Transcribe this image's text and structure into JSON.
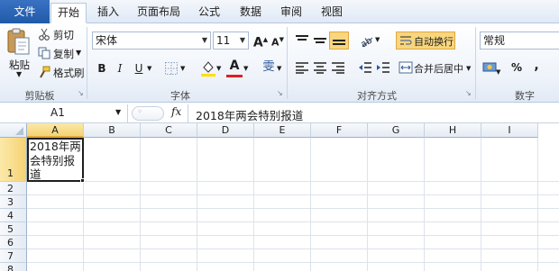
{
  "tabs": [
    {
      "label": "文件",
      "kind": "file"
    },
    {
      "label": "开始",
      "kind": "active"
    },
    {
      "label": "插入"
    },
    {
      "label": "页面布局"
    },
    {
      "label": "公式"
    },
    {
      "label": "数据"
    },
    {
      "label": "审阅"
    },
    {
      "label": "视图"
    }
  ],
  "clipboard": {
    "paste": "粘贴",
    "cut": "剪切",
    "copy": "复制",
    "format_painter": "格式刷",
    "group": "剪贴板"
  },
  "font": {
    "name": "宋体",
    "size": "11",
    "grow": "A",
    "shrink": "A",
    "bold": "B",
    "italic": "I",
    "underline": "U",
    "font_color_glyph": "A",
    "phonetic_glyph": "雯",
    "group": "字体"
  },
  "alignment": {
    "wrap_text": "自动换行",
    "merge_center": "合并后居中",
    "group": "对齐方式"
  },
  "number": {
    "format": "常规",
    "percent": "%",
    "comma": ",",
    "group": "数字"
  },
  "formula_bar": {
    "name_box": "A1",
    "fx": "fx",
    "content": "2018年两会特别报道"
  },
  "sheet": {
    "columns": [
      "A",
      "B",
      "C",
      "D",
      "E",
      "F",
      "G",
      "H",
      "I"
    ],
    "rows": [
      "1",
      "2",
      "3",
      "4",
      "5",
      "6",
      "7",
      "8"
    ],
    "a1_lines": [
      "2018年两",
      "会特别报",
      "道"
    ]
  },
  "colors": {
    "file_tab": "#2b579a",
    "selection_header": "#f6d274",
    "font_color_bar": "#e02020",
    "fill_color_bar": "#ffe000",
    "accent": "#2b579a"
  }
}
